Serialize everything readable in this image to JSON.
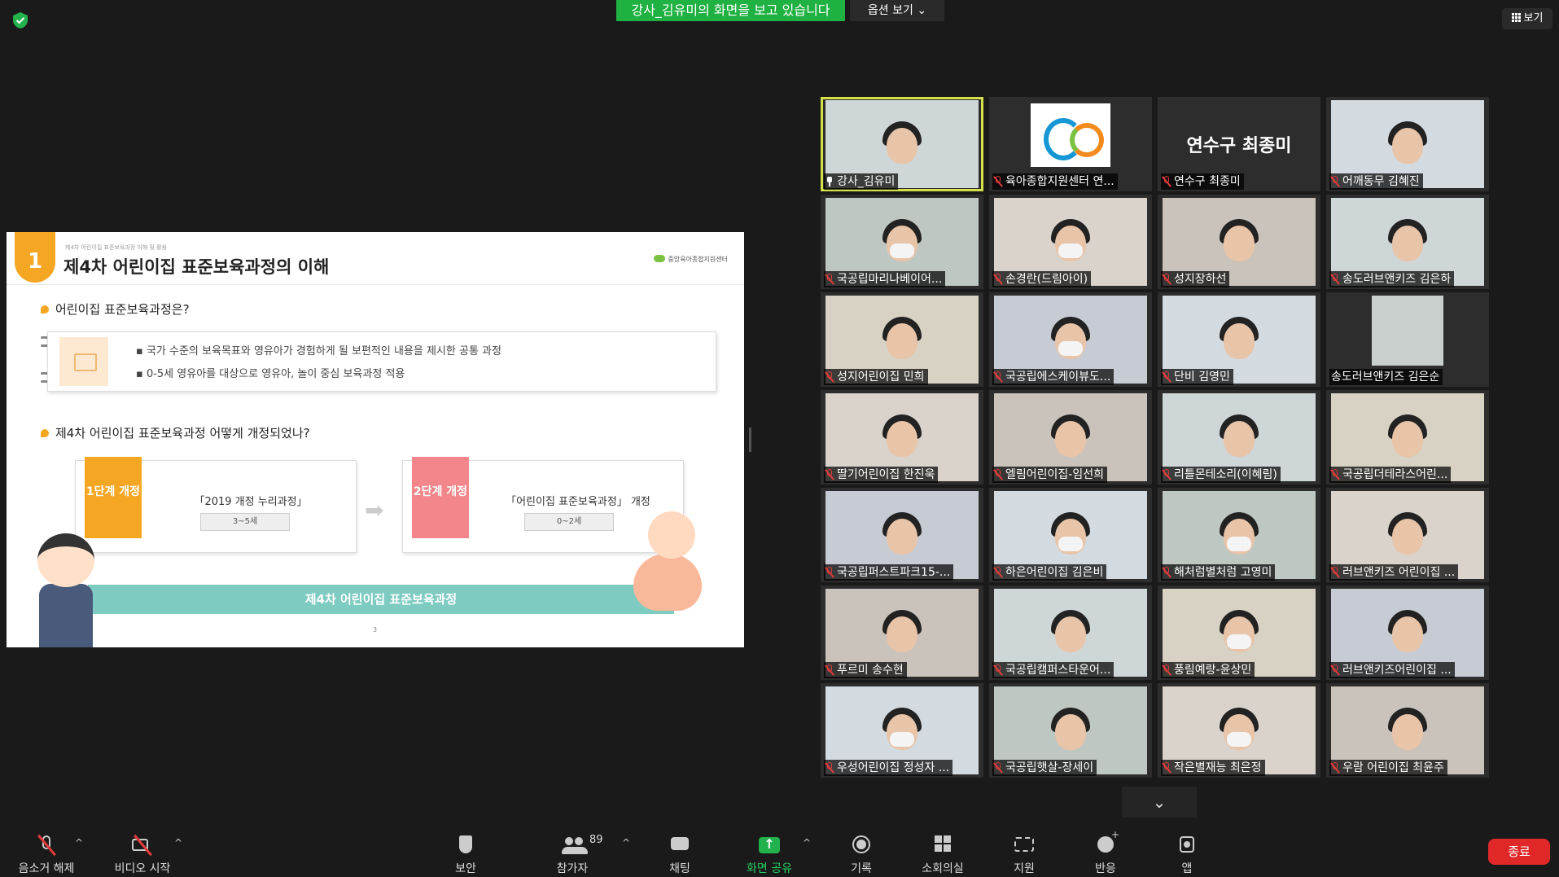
{
  "top": {
    "share_banner": "강사_김유미의 화면을 보고 있습니다",
    "options": "옵션 보기 ⌄",
    "view": "보기"
  },
  "slide": {
    "number": "1",
    "small_header": "제4차 어린이집 표준보육과정 이해 및 활용",
    "title": "제4차 어린이집 표준보육과정의 이해",
    "logo_text": "중앙육아종합지원센터",
    "q1": "어린이집 표준보육과정은?",
    "bullet1": "국가 수준의 보육목표와 영유아가 경험하게 될 보편적인 내용을 제시한 공통 과정",
    "bullet2": "0-5세 영유아를 대상으로 영유아, 놀이 중심 보육과정 적용",
    "q2": "제4차 어린이집 표준보육과정 어떻게 개정되었나?",
    "step1_tag": "1단계 개정",
    "step1_text": "「2019 개정 누리과정」",
    "step1_age": "3~5세",
    "step2_tag": "2단계 개정",
    "step2_text": "「어린이집 표준보육과정」 개정",
    "step2_age": "0~2세",
    "bar": "제4차 어린이집 표준보육과정",
    "page": "3"
  },
  "participants": [
    {
      "name": "강사_김유미",
      "type": "video",
      "active": true,
      "pinned": true
    },
    {
      "name": "육아종합지원센터 연...",
      "type": "logo",
      "active": false
    },
    {
      "name": "연수구 최종미",
      "type": "text",
      "big": "연수구  최종미"
    },
    {
      "name": "어깨동무 김혜진",
      "type": "video"
    },
    {
      "name": "국공립마리나베이어...",
      "type": "video",
      "mask": true
    },
    {
      "name": "손경란(드림아이)",
      "type": "video",
      "mask": true
    },
    {
      "name": "성지장하선",
      "type": "video"
    },
    {
      "name": "송도러브앤키즈 김은하",
      "type": "video"
    },
    {
      "name": "성지어린이집 민희",
      "type": "video"
    },
    {
      "name": "국공립에스케이뷰도...",
      "type": "video",
      "mask": true
    },
    {
      "name": "단비 김영민",
      "type": "video"
    },
    {
      "name": "송도러브앤키즈 김은순",
      "type": "novideo"
    },
    {
      "name": "딸기어린이집 한진욱",
      "type": "video"
    },
    {
      "name": "엘림어린이집-임선희",
      "type": "video"
    },
    {
      "name": "리틀몬테소리(이혜림)",
      "type": "video"
    },
    {
      "name": "국공립더테라스어린...",
      "type": "video"
    },
    {
      "name": "국공립퍼스트파크15-...",
      "type": "video"
    },
    {
      "name": "하은어린이집 김은비",
      "type": "video",
      "mask": true
    },
    {
      "name": "해처럼별처럼 고영미",
      "type": "video",
      "mask": true
    },
    {
      "name": "러브앤키즈 어린이집 ...",
      "type": "video"
    },
    {
      "name": "푸르미 송수현",
      "type": "video"
    },
    {
      "name": "국공립캠퍼스타운어...",
      "type": "video"
    },
    {
      "name": "풍림예랑-윤상민",
      "type": "video",
      "mask": true
    },
    {
      "name": "러브앤키즈어린이집 ...",
      "type": "video"
    },
    {
      "name": "우성어린이집 정성자 ...",
      "type": "video",
      "mask": true
    },
    {
      "name": "국공립햇살-장세이",
      "type": "video"
    },
    {
      "name": "작은별재능 최은정",
      "type": "video",
      "mask": true
    },
    {
      "name": "우람 어린이집 최윤주",
      "type": "video"
    }
  ],
  "toolbar": {
    "mute": "음소거 해제",
    "video": "비디오 시작",
    "security": "보안",
    "participants": "참가자",
    "participants_count": "89",
    "chat": "채팅",
    "share": "화면 공유",
    "record": "기록",
    "rooms": "소회의실",
    "support": "지원",
    "reactions": "반응",
    "apps": "앱",
    "end": "종료"
  },
  "colors": {
    "banner_green": "#1fb141",
    "active_speaker": "#d6e14a",
    "end_red": "#e02828",
    "slide_orange": "#f5a623",
    "slide_teal": "#7ecbc2"
  }
}
